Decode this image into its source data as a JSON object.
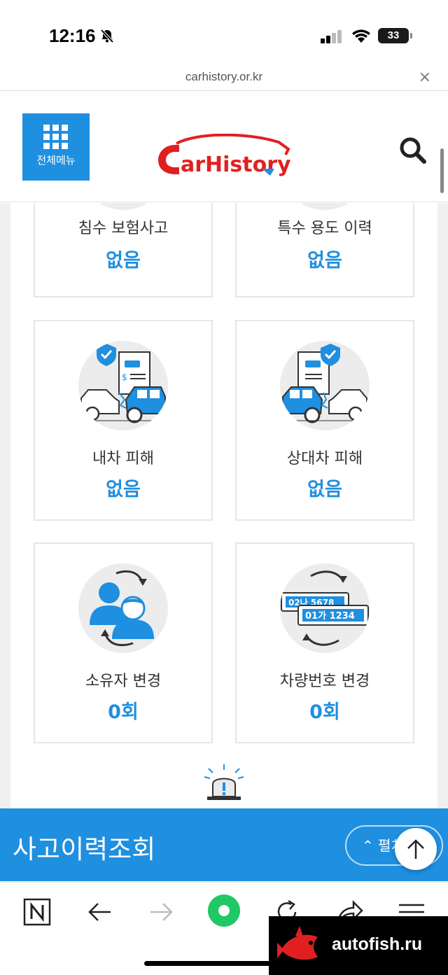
{
  "status_bar": {
    "time": "12:16",
    "battery": "33"
  },
  "browser": {
    "url": "carhistory.or.kr",
    "close": "×"
  },
  "header": {
    "menu_label": "전체메뉴",
    "logo_text": "CarHistory"
  },
  "cards": [
    {
      "label": "침수 보험사고",
      "value": "없음",
      "icon": "flood-icon"
    },
    {
      "label": "특수 용도 이력",
      "value": "없음",
      "icon": "special-use-icon"
    },
    {
      "label": "내차 피해",
      "value": "없음",
      "icon": "my-car-damage-icon"
    },
    {
      "label": "상대차 피해",
      "value": "없음",
      "icon": "other-car-damage-icon"
    },
    {
      "label": "소유자 변경",
      "value": "0회",
      "icon": "owner-change-icon"
    },
    {
      "label": "차량번호 변경",
      "value": "0회",
      "icon": "plate-change-icon"
    }
  ],
  "plates": {
    "back": "02나 5678",
    "front": "01가 1234"
  },
  "accident_bar": {
    "title": "사고이력조회",
    "expand_label": "펼치"
  },
  "watermark": {
    "text": "autofish.ru"
  },
  "colors": {
    "accent": "#1f8fe0",
    "card_border": "#e6e6e6",
    "logo_red": "#e02020"
  }
}
